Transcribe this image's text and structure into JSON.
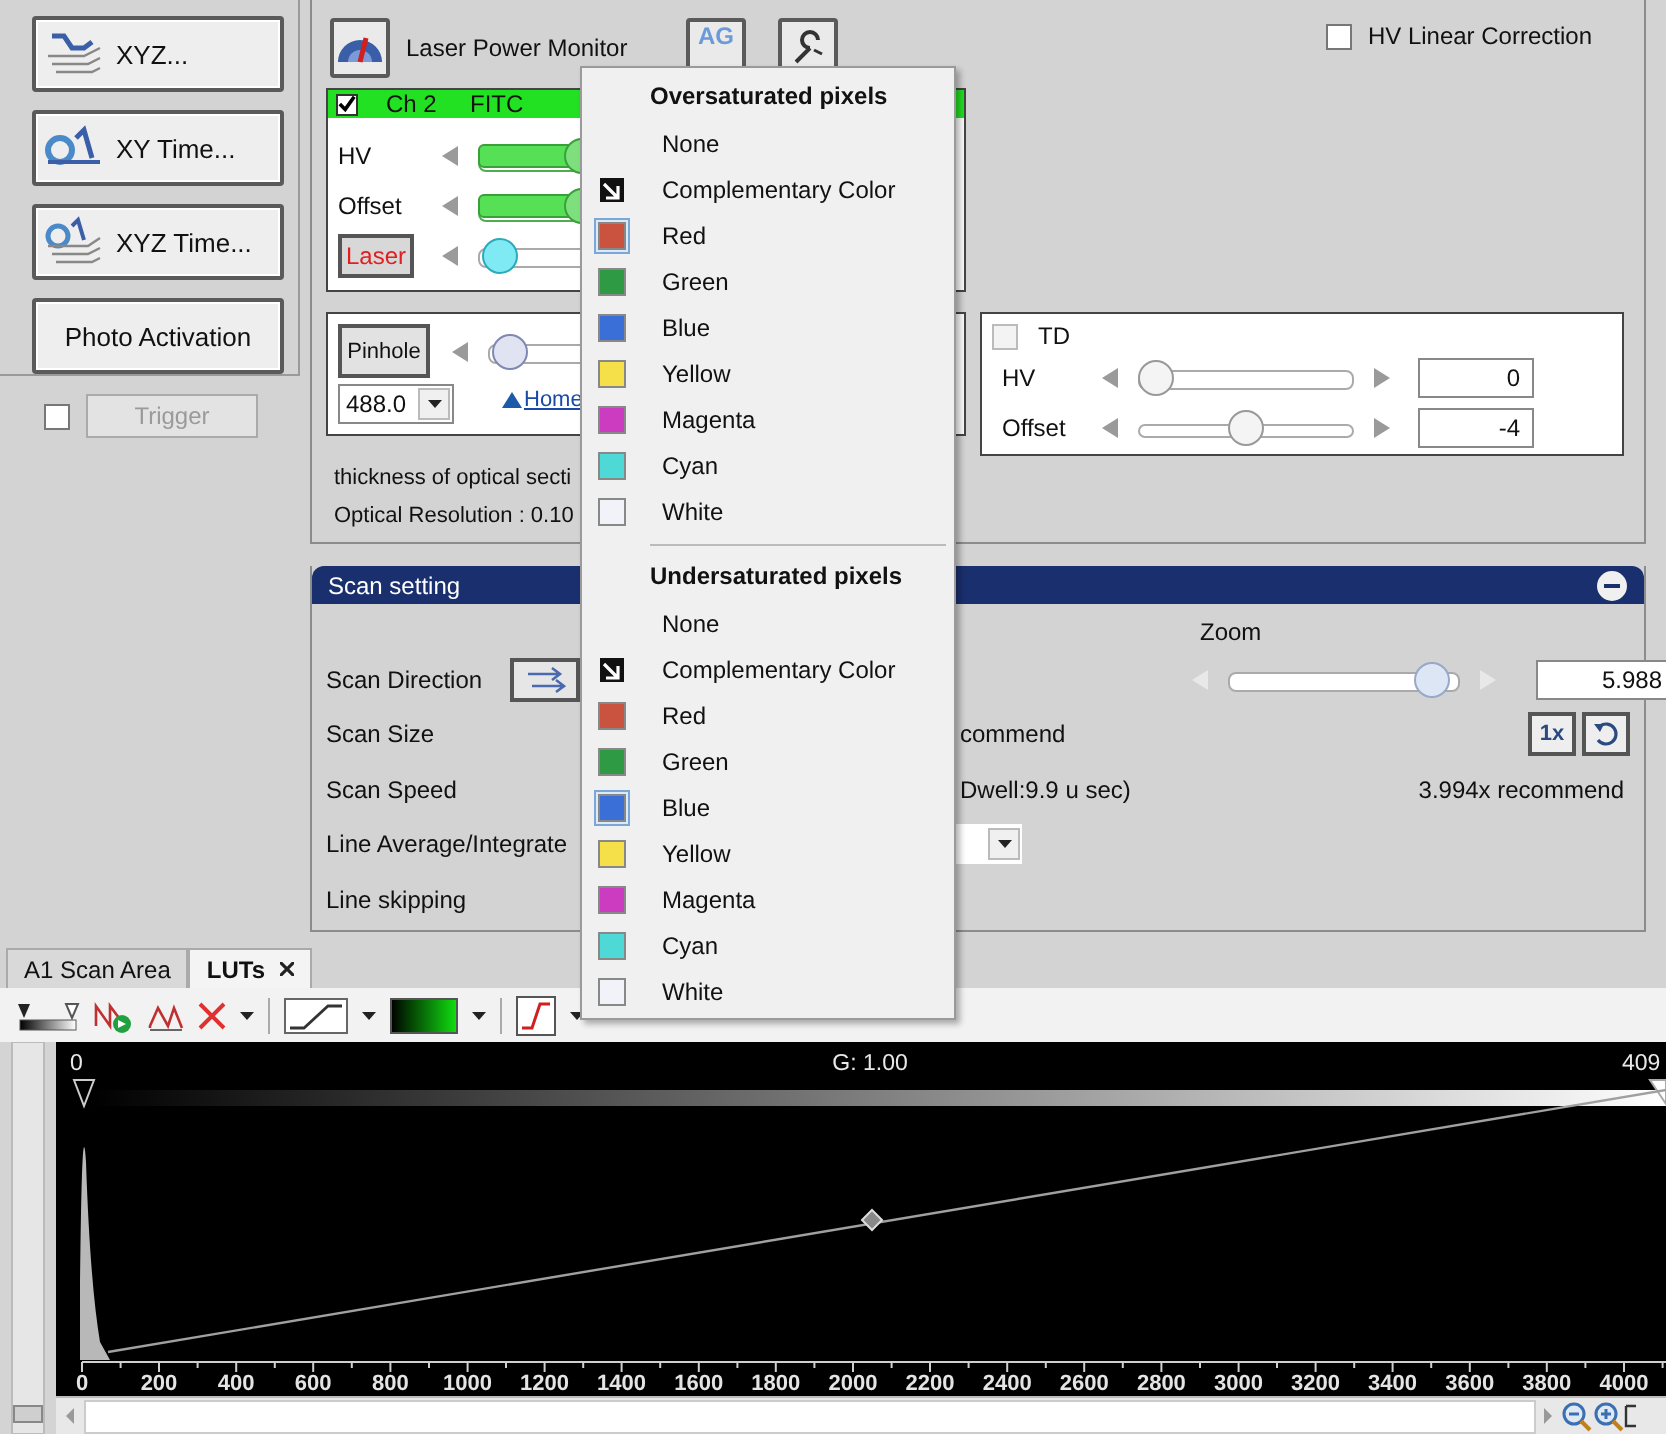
{
  "left_buttons": [
    {
      "label": "XYZ...",
      "kind": "xyz"
    },
    {
      "label": "XY Time...",
      "kind": "time"
    },
    {
      "label": "XYZ Time...",
      "kind": "ztime"
    },
    {
      "label": "Photo Activation",
      "kind": "plain"
    }
  ],
  "trigger": {
    "label": "Trigger",
    "checked": false,
    "disabled": true
  },
  "laser_power_monitor": {
    "label": "Laser Power Monitor"
  },
  "ag_button": {
    "label": "AG"
  },
  "hv_linear_correction": {
    "label": "HV Linear Correction",
    "checked": false
  },
  "channel": {
    "checked": true,
    "name": "Ch 2",
    "dye": "FITC",
    "sliders": [
      {
        "label": "HV",
        "kind": "plain",
        "level": 0.42
      },
      {
        "label": "Offset",
        "kind": "plain",
        "level": 0.42
      },
      {
        "label": "Laser",
        "kind": "button",
        "level": 0.02
      }
    ]
  },
  "pinhole": {
    "label": "Pinhole",
    "level": 0.02,
    "wavelength": "488.0",
    "home_link": "Home"
  },
  "info_lines": [
    "thickness of optical secti",
    "Optical Resolution : 0.10"
  ],
  "td": {
    "label": "TD",
    "checked": false,
    "sliders": [
      {
        "label": "HV",
        "level": 0,
        "value": "0"
      },
      {
        "label": "Offset",
        "level": 0.5,
        "value": "-4"
      }
    ]
  },
  "scan_setting": {
    "title": "Scan setting",
    "rows": [
      {
        "label": "Scan Direction",
        "kind": "direction"
      },
      {
        "label": "Scan Size",
        "kind": "text",
        "text": "commend"
      },
      {
        "label": "Scan Speed",
        "kind": "text",
        "text": "Dwell:9.9 u sec)"
      },
      {
        "label": "Line Average/Integrate",
        "kind": "dropdown"
      },
      {
        "label": "Line skipping",
        "kind": "plain"
      }
    ],
    "zoom": {
      "label": "Zoom",
      "level": 0.95,
      "value": "5.988",
      "reset_label": "1x"
    },
    "recommend": "3.994x recommend"
  },
  "tabs": [
    {
      "label": "A1 Scan Area",
      "selected": false,
      "closable": false
    },
    {
      "label": "LUTs",
      "selected": true,
      "closable": true
    }
  ],
  "lut": {
    "left_label": "0",
    "gamma_label": "G: 1.00",
    "right_label": "409",
    "x_tick_labels": [
      "0",
      "200",
      "400",
      "600",
      "800",
      "1000",
      "1200",
      "1400",
      "1600",
      "1800",
      "2000",
      "2200",
      "2400",
      "2600",
      "2800",
      "3000",
      "3200",
      "3400",
      "3600",
      "3800",
      "4000"
    ]
  },
  "color_menu": {
    "sections": [
      {
        "title": "Oversaturated pixels",
        "items": [
          {
            "label": "None",
            "kind": "none",
            "selected": false
          },
          {
            "label": "Complementary Color",
            "kind": "complementary",
            "selected": false
          },
          {
            "label": "Red",
            "kind": "swatch",
            "color": "#c9533f",
            "selected": true
          },
          {
            "label": "Green",
            "kind": "swatch",
            "color": "#2e9a44",
            "selected": false
          },
          {
            "label": "Blue",
            "kind": "swatch",
            "color": "#3a6fd8",
            "selected": false
          },
          {
            "label": "Yellow",
            "kind": "swatch",
            "color": "#f5e04a",
            "selected": false
          },
          {
            "label": "Magenta",
            "kind": "swatch",
            "color": "#cc3cc0",
            "selected": false
          },
          {
            "label": "Cyan",
            "kind": "swatch",
            "color": "#4fd9d6",
            "selected": false
          },
          {
            "label": "White",
            "kind": "swatch",
            "color": "#f2f3f8",
            "selected": false
          }
        ]
      },
      {
        "title": "Undersaturated pixels",
        "items": [
          {
            "label": "None",
            "kind": "none",
            "selected": false
          },
          {
            "label": "Complementary Color",
            "kind": "complementary",
            "selected": false
          },
          {
            "label": "Red",
            "kind": "swatch",
            "color": "#c9533f",
            "selected": false
          },
          {
            "label": "Green",
            "kind": "swatch",
            "color": "#2e9a44",
            "selected": false
          },
          {
            "label": "Blue",
            "kind": "swatch",
            "color": "#3a6fd8",
            "selected": true
          },
          {
            "label": "Yellow",
            "kind": "swatch",
            "color": "#f5e04a",
            "selected": false
          },
          {
            "label": "Magenta",
            "kind": "swatch",
            "color": "#cc3cc0",
            "selected": false
          },
          {
            "label": "Cyan",
            "kind": "swatch",
            "color": "#4fd9d6",
            "selected": false
          },
          {
            "label": "White",
            "kind": "swatch",
            "color": "#f2f3f8",
            "selected": false
          }
        ]
      }
    ]
  }
}
